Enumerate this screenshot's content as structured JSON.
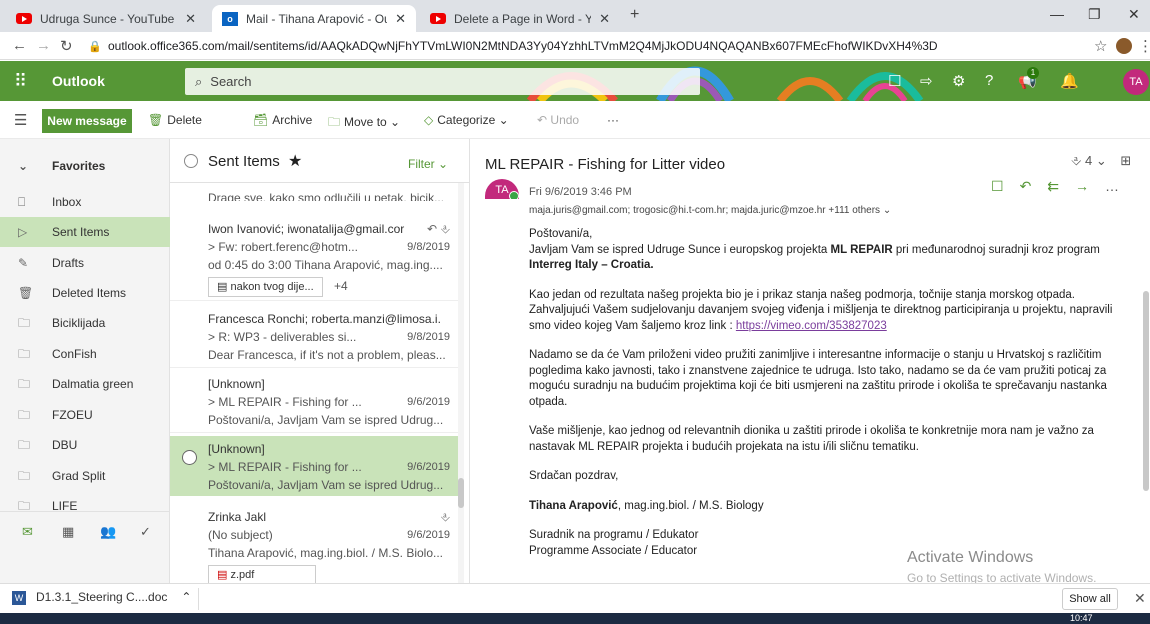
{
  "browser": {
    "tabs": [
      {
        "title": "Udruga Sunce - YouTube",
        "icon": "youtube-icon"
      },
      {
        "title": "Mail - Tihana Arapović - Outlook",
        "icon": "outlook-icon"
      },
      {
        "title": "Delete a Page in Word - YouTube",
        "icon": "youtube-icon"
      }
    ],
    "new_tab": "+",
    "url": "outlook.office365.com/mail/sentitems/id/AAQkADQwNjFhYTVmLWI0N2MtNDA3Yy04YzhhLTVmM2Q4MjJkODU4NQAQANBx607FMEcFhofWIKDvXH4%3D"
  },
  "header": {
    "app_name": "Outlook",
    "search_placeholder": "Search",
    "avatar_initials": "TA",
    "notification_count": "1",
    "brand_color": "#569736"
  },
  "commands": {
    "new_message": "New message",
    "delete": "Delete",
    "archive": "Archive",
    "move_to": "Move to",
    "categorize": "Categorize",
    "undo": "Undo",
    "more": "···"
  },
  "nav": {
    "favorites": "Favorites",
    "folders": [
      {
        "label": "Inbox",
        "icon": "inbox-icon"
      },
      {
        "label": "Sent Items",
        "icon": "send-icon"
      },
      {
        "label": "Drafts",
        "icon": "pencil-icon"
      },
      {
        "label": "Deleted Items",
        "icon": "trash-icon"
      },
      {
        "label": "Biciklijada",
        "icon": "folder-icon"
      },
      {
        "label": "ConFish",
        "icon": "folder-icon"
      },
      {
        "label": "Dalmatia green",
        "icon": "folder-icon"
      },
      {
        "label": "FZOEU",
        "icon": "folder-icon"
      },
      {
        "label": "DBU",
        "icon": "folder-icon"
      },
      {
        "label": "Grad Split",
        "icon": "folder-icon"
      },
      {
        "label": "LIFE",
        "icon": "folder-icon"
      }
    ]
  },
  "list": {
    "title": "Sent Items",
    "filter": "Filter",
    "messages": [
      {
        "to": "",
        "subject": "",
        "preview": "Drage sve, kako smo odlučili u petak, bicik...",
        "date": ""
      },
      {
        "to": "Iwon Ivanović; iwonatalija@gmail.cor",
        "subject": "> Fw: robert.ferenc@hotm...",
        "preview": "od 0:45 do 3:00 Tihana Arapović, mag.ing....",
        "date": "9/8/2019",
        "attachment": "nakon tvog dije...",
        "more": "+4"
      },
      {
        "to": "Francesca Ronchi; roberta.manzi@limosa.i.",
        "subject": "> R: WP3 - deliverables si...",
        "preview": "Dear Francesca, if it's not a problem, pleas...",
        "date": "9/8/2019"
      },
      {
        "to": "[Unknown]",
        "subject": "> ML REPAIR - Fishing for ...",
        "preview": "Poštovani/a, Javljam Vam se ispred Udrug...",
        "date": "9/6/2019"
      },
      {
        "to": "[Unknown]",
        "subject": "> ML REPAIR - Fishing for ...",
        "preview": "Poštovani/a, Javljam Vam se ispred Udrug...",
        "date": "9/6/2019"
      },
      {
        "to": "Zrinka Jakl",
        "subject": "(No subject)",
        "preview": "Tihana Arapović, mag.ing.biol. / M.S. Biolo...",
        "date": "9/6/2019",
        "attachment": "z.pdf"
      }
    ]
  },
  "reading": {
    "subject": "ML REPAIR - Fishing for Litter video",
    "attachments_count": "4",
    "sender_initials": "TA",
    "sent": "Fri 9/6/2019 3:46 PM",
    "recipients": "maja.juris@gmail.com; trogosic@hi.t-com.hr; majda.juric@mzoe.hr +111 others",
    "body": {
      "greeting": "Poštovani/a,",
      "p1a": "Javljam Vam se ispred Udruge Sunce i europskog projekta ",
      "p1b": "ML REPAIR",
      "p1c": " pri međunarodnoj suradnji kroz program ",
      "p1d": "Interreg Italy – Croatia.",
      "p2": "Kao jedan od rezultata našeg projekta bio je i prikaz stanja našeg podmorja, točnije stanja morskog otpada. Zahvaljujući Vašem sudjelovanju davanjem svojeg viđenja i mišljenja te direktnog participiranja u projektu, napravili smo video kojeg Vam šaljemo kroz link : ",
      "link": "https://vimeo.com/353827023",
      "p3": "Nadamo se da će Vam priloženi video pružiti zanimljive i interesantne informacije o stanju u Hrvatskoj s različitim pogledima kako javnosti, tako i znanstvene zajednice te udruga. Isto tako, nadamo se da će vam pružiti poticaj za moguću suradnju na budućim projektima koji će biti usmjereni na zaštitu prirode i okoliša te sprečavanju nastanka otpada.",
      "p4": "Vaše mišljenje, kao jednog od relevantnih dionika u zaštiti prirode i okoliša te konkretnije mora nam je važno za nastavak ML REPAIR projekta i budućih projekata na istu i/ili sličnu tematiku.",
      "closing": "Srdačan pozdrav,",
      "sig_name": "Tihana Arapović",
      "sig_title": ", mag.ing.biol. / M.S. Biology",
      "sig_role1": "Suradnik na programu / Edukator",
      "sig_role2": "Programme Associate / Educator"
    },
    "watermark1": "Activate Windows",
    "watermark2": "Go to Settings to activate Windows."
  },
  "download": {
    "file": "D1.3.1_Steering C....doc",
    "show_all": "Show all"
  },
  "taskbar": {
    "time": "10:47"
  }
}
